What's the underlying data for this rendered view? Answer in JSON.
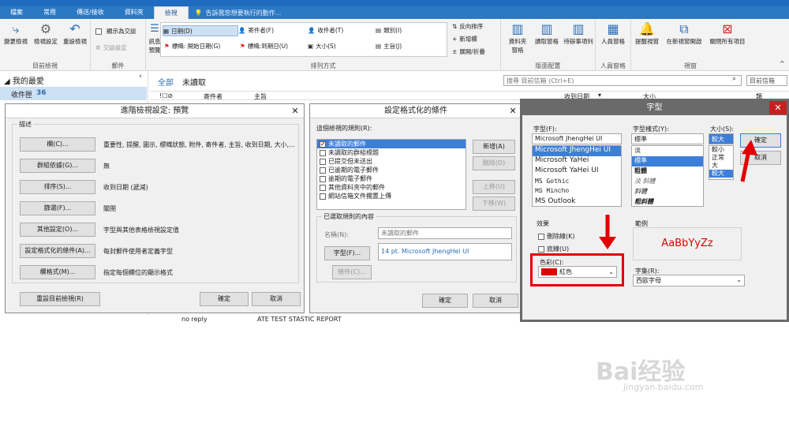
{
  "ribbon": {
    "tabs": [
      "檔案",
      "常用",
      "傳送/接收",
      "資料夾",
      "檢視"
    ],
    "active_tab": "檢視",
    "tellme": "告訴我您想要執行的動作...",
    "current_view": {
      "change_view": "變更檢視",
      "view_settings": "檢視設定",
      "reset_view": "重設檢視",
      "label": "目前檢視"
    },
    "messages": {
      "show_as_conv": "顯示為交談",
      "conv_settings": "交談設定",
      "label": "郵件"
    },
    "arrangement": {
      "preview": "訊息\n預覽",
      "items": [
        "日期(D)",
        "寄件者(F)",
        "收件者(T)",
        "類別(I)",
        "標幟: 開始日期(G)",
        "標幟:到期日(U)",
        "大小(S)",
        "主旨(J)"
      ],
      "reverse_sort": "反向排序",
      "add_columns": "新增欄",
      "expand": "展開/折疊",
      "label": "排列方式"
    },
    "layout": {
      "folder_pane": "資料夾\n窗格",
      "reading_pane": "讀取窗格",
      "todo_bar": "待辦事項列",
      "label": "版面配置"
    },
    "people": {
      "people_pane": "人員窗格",
      "label": "人員窗格"
    },
    "window": {
      "reminders": "提醒視窗",
      "open_new": "在新視窗開啟",
      "close_all": "關閉所有項目",
      "label": "視窗"
    }
  },
  "nav": {
    "favorites": "我的最愛",
    "inbox": "收件匣",
    "inbox_count": "36"
  },
  "mail": {
    "filter_all": "全部",
    "filter_unread": "未讀取",
    "search_placeholder": "搜尋 目前信箱 (Ctrl+E)",
    "scope": "目前信箱",
    "col_from": "寄件者",
    "col_subject": "主旨",
    "col_received": "收到日期",
    "col_size": "大小",
    "col_category": "類",
    "row_from": "no reply",
    "row_subject": "ATE TEST STASTIC REPORT"
  },
  "adv_dialog": {
    "title": "進階檢視設定: 預覽",
    "desc_label": "描述",
    "rows": [
      {
        "button": "欄(C)...",
        "value": "重要性, 提醒, 圖示, 標幟狀態, 附件, 寄件者, 主旨, 收到日期, 大小,..."
      },
      {
        "button": "群組依據(G)...",
        "value": "無"
      },
      {
        "button": "排序(S)...",
        "value": "收到日期 (遞減)"
      },
      {
        "button": "篩選(F)...",
        "value": "關閉"
      },
      {
        "button": "其他設定(O)...",
        "value": "字型與其他表格檢視設定值"
      },
      {
        "button": "設定格式化的條件(A)...",
        "value": "每封郵件使用者定義字型"
      },
      {
        "button": "欄格式(M)...",
        "value": "指定每個欄位的顯示格式"
      }
    ],
    "reset": "重設目前檢視(R)",
    "ok": "確定",
    "cancel": "取消"
  },
  "cond_dialog": {
    "title": "設定格式化的條件",
    "rules_label": "這個檢視的規則(R):",
    "rules": [
      {
        "label": "未讀取的郵件",
        "checked": true,
        "selected": true
      },
      {
        "label": "未讀取的群組標題",
        "checked": false
      },
      {
        "label": "已提交但未送出",
        "checked": false
      },
      {
        "label": "已逾期的電子郵件",
        "checked": false
      },
      {
        "label": "逾期的電子郵件",
        "checked": false
      },
      {
        "label": "其他資料夾中的郵件",
        "checked": false
      },
      {
        "label": "網站信箱文件擱置上傳",
        "checked": false
      }
    ],
    "add": "新增(A)",
    "delete": "刪除(D)",
    "up": "上移(U)",
    "down": "下移(W)",
    "props_label": "已選取規則的內容",
    "name_label": "名稱(N):",
    "name_value": "未讀取的郵件",
    "font_button": "字型(F)...",
    "font_value": "14 pt. Microsoft JhengHei UI",
    "condition_button": "條件(C)...",
    "ok": "確定",
    "cancel": "取消"
  },
  "font_dialog": {
    "title": "字型",
    "font_label": "字型(F):",
    "font_value": "Microsoft JhengHei UI",
    "fonts": [
      "Microsoft JhengHei UI",
      "Microsoft YaHei",
      "Microsoft YaHei UI",
      "MS Gothic",
      "MS Mincho",
      "MS Outlook"
    ],
    "style_label": "字型樣式(Y):",
    "style_value": "標準",
    "styles": [
      "淡",
      "標準",
      "粗體",
      "淡 斜體",
      "斜體",
      "粗斜體"
    ],
    "size_label": "大小(S):",
    "size_value": "較大",
    "sizes": [
      "較小",
      "正常",
      "大",
      "較大"
    ],
    "ok": "確定",
    "cancel": "取消",
    "effects_label": "效果",
    "strike": "刪除線(K)",
    "underline": "底線(U)",
    "color_label": "色彩(C):",
    "color_value": "紅色",
    "color_hex": "#e00000",
    "sample_label": "範例",
    "sample_text": "AaBbYyZz",
    "script_label": "字集(R):",
    "script_value": "西歐字母"
  },
  "watermark": {
    "brand": "Bai经验",
    "url": "jingyan.baidu.com"
  }
}
